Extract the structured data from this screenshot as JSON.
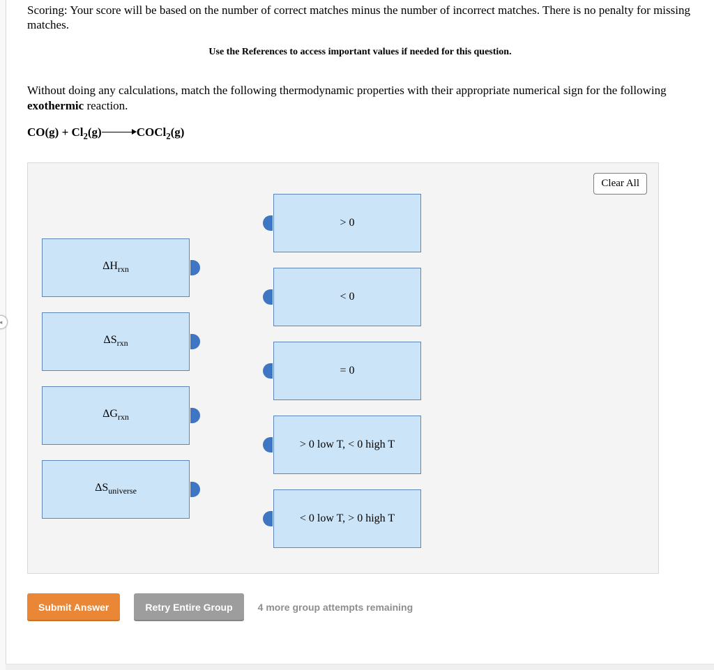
{
  "scoring": "Scoring: Your score will be based on the number of correct matches minus the number of incorrect matches. There is no penalty for missing matches.",
  "references_note": "Use the References to access important values if needed for this question.",
  "prompt": {
    "line1": "Without doing any calculations, match the following thermodynamic properties with their appropriate numerical sign for the following ",
    "bold": "exothermic",
    "line2": " reaction."
  },
  "equation": {
    "lhs": "CO(g) + Cl",
    "lhs_sub": "2",
    "lhs_tail": "(g)",
    "rhs": "COCl",
    "rhs_sub": "2",
    "rhs_tail": "(g)"
  },
  "clear_all": "Clear All",
  "left_tiles": [
    {
      "symbol": "ΔH",
      "subscript": "rxn"
    },
    {
      "symbol": "ΔS",
      "subscript": "rxn"
    },
    {
      "symbol": "ΔG",
      "subscript": "rxn"
    },
    {
      "symbol": "ΔS",
      "subscript": "universe"
    }
  ],
  "right_tiles": [
    {
      "text": "> 0"
    },
    {
      "text": "< 0"
    },
    {
      "text": "= 0"
    },
    {
      "text": "> 0 low T, < 0 high T"
    },
    {
      "text": "< 0 low T, > 0 high T"
    }
  ],
  "buttons": {
    "submit": "Submit Answer",
    "retry": "Retry Entire Group"
  },
  "attempts_remaining": "4 more group attempts remaining"
}
